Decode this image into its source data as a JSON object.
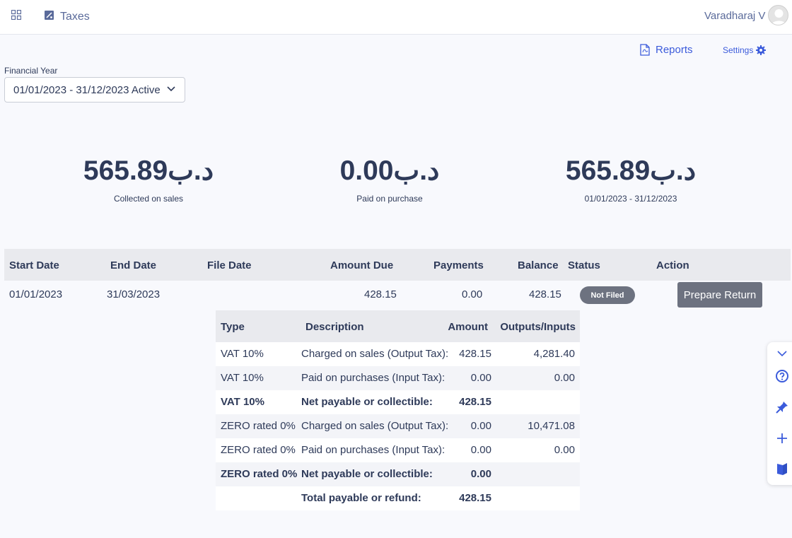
{
  "header": {
    "app_title": "Taxes",
    "user_name": "Varadharaj V",
    "icons": {
      "apps": "apps-grid-icon",
      "taxes": "taxes-icon",
      "avatar": "user-avatar"
    }
  },
  "toolbar": {
    "reports_label": "Reports",
    "settings_label": "Settings",
    "icons": {
      "reports": "pdf-icon",
      "settings": "gear-icon"
    }
  },
  "financial_year": {
    "label": "Financial Year",
    "selected": "01/01/2023 - 31/12/2023  Active"
  },
  "summary": [
    {
      "amount": "د.ب565.89",
      "label": "Collected on sales"
    },
    {
      "amount": "د.ب0.00",
      "label": "Paid on purchase"
    },
    {
      "amount": "د.ب565.89",
      "label": "01/01/2023 - 31/12/2023"
    }
  ],
  "returns_table": {
    "columns": [
      "Start Date",
      "End Date",
      "File Date",
      "Amount Due",
      "Payments",
      "Balance",
      "Status",
      "Action"
    ],
    "rows": [
      {
        "start_date": "01/01/2023",
        "end_date": "31/03/2023",
        "file_date": "",
        "amount_due": "428.15",
        "payments": "0.00",
        "balance": "428.15",
        "status": "Not Filed",
        "action": "Prepare Return"
      }
    ]
  },
  "breakdown": {
    "columns": [
      "Type",
      "Description",
      "Amount",
      "Outputs/Inputs"
    ],
    "rows": [
      {
        "type": "VAT 10%",
        "description": "Charged on sales (Output Tax):",
        "amount": "428.15",
        "outputs": "4,281.40",
        "bold": false
      },
      {
        "type": "VAT 10%",
        "description": "Paid on purchases (Input Tax):",
        "amount": "0.00",
        "outputs": "0.00",
        "bold": false
      },
      {
        "type": "VAT 10%",
        "description": "Net payable or collectible:",
        "amount": "428.15",
        "outputs": "",
        "bold": true
      },
      {
        "type": "ZERO rated 0%",
        "description": "Charged on sales (Output Tax):",
        "amount": "0.00",
        "outputs": "10,471.08",
        "bold": false
      },
      {
        "type": "ZERO rated 0%",
        "description": "Paid on purchases (Input Tax):",
        "amount": "0.00",
        "outputs": "0.00",
        "bold": false
      },
      {
        "type": "ZERO rated 0%",
        "description": "Net payable or collectible:",
        "amount": "0.00",
        "outputs": "",
        "bold": true
      },
      {
        "type": "",
        "description": "Total payable or refund:",
        "amount": "428.15",
        "outputs": "",
        "bold": true
      }
    ]
  },
  "side_panel": {
    "icons": [
      "chevron-down-icon",
      "help-icon",
      "pin-icon",
      "plus-icon",
      "book-icon"
    ]
  },
  "colors": {
    "accent": "#3b5bdb",
    "text": "#2e3a59",
    "badge": "#6d7280",
    "header_bg": "#e9eaee"
  }
}
